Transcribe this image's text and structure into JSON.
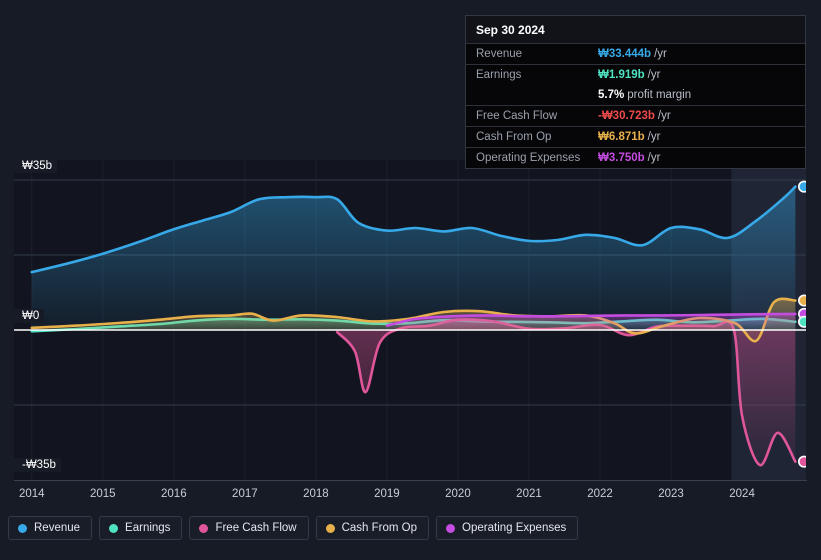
{
  "chart_data": {
    "type": "area",
    "title": "",
    "xlabel": "",
    "ylabel": "",
    "currency_symbol": "₩",
    "units": "b",
    "grid": true,
    "legend_position": "bottom",
    "xlim": [
      2013.75,
      2024.9
    ],
    "ylim": [
      -35,
      35
    ],
    "x_ticks": [
      "2014",
      "2015",
      "2016",
      "2017",
      "2018",
      "2019",
      "2020",
      "2021",
      "2022",
      "2023",
      "2024"
    ],
    "y_ticks": [
      "₩35b",
      "₩0",
      "-₩35b"
    ],
    "y_tick_values": [
      35,
      0,
      -35
    ],
    "gridline_values": [
      35,
      17.5,
      -17.5
    ],
    "zero_line_value": 0,
    "forecast_band_start_x": 2023.85,
    "series": [
      {
        "name": "Revenue",
        "color": "#37a9e8",
        "x": [
          2014.0,
          2014.5,
          2015.0,
          2015.5,
          2016.0,
          2016.4,
          2016.8,
          2017.2,
          2017.6,
          2018.0,
          2018.3,
          2018.6,
          2019.0,
          2019.4,
          2019.8,
          2020.2,
          2020.6,
          2021.0,
          2021.4,
          2021.8,
          2022.2,
          2022.6,
          2023.0,
          2023.4,
          2023.8,
          2024.2,
          2024.6,
          2024.75
        ],
        "values": [
          13.5,
          15.5,
          17.8,
          20.5,
          23.5,
          25.5,
          27.5,
          30.5,
          31.0,
          31.0,
          30.5,
          25.0,
          23.2,
          23.8,
          23.0,
          23.8,
          22.0,
          20.8,
          21.0,
          22.2,
          21.5,
          19.8,
          23.8,
          23.5,
          21.5,
          25.5,
          31.0,
          33.444
        ]
      },
      {
        "name": "Earnings",
        "color": "#50e3c2",
        "x": [
          2014.0,
          2014.6,
          2015.2,
          2015.8,
          2016.3,
          2016.8,
          2017.3,
          2017.8,
          2018.3,
          2018.8,
          2019.3,
          2019.8,
          2020.3,
          2020.8,
          2021.3,
          2021.8,
          2022.3,
          2022.8,
          2023.3,
          2023.8,
          2024.3,
          2024.75
        ],
        "values": [
          -0.3,
          0.2,
          0.8,
          1.4,
          2.2,
          2.6,
          2.4,
          2.5,
          2.2,
          1.5,
          1.6,
          2.3,
          2.0,
          1.9,
          1.8,
          1.6,
          2.0,
          2.4,
          1.8,
          2.2,
          2.6,
          1.919
        ]
      },
      {
        "name": "Free Cash Flow",
        "color": "#e0569a",
        "x": [
          2018.3,
          2018.55,
          2018.7,
          2018.9,
          2019.2,
          2019.6,
          2020.0,
          2020.5,
          2021.0,
          2021.5,
          2022.0,
          2022.4,
          2022.8,
          2023.2,
          2023.6,
          2023.88,
          2024.0,
          2024.25,
          2024.5,
          2024.75
        ],
        "values": [
          -0.5,
          -5.0,
          -14.5,
          -3.0,
          0.4,
          1.0,
          2.4,
          2.0,
          0.3,
          0.4,
          1.2,
          -1.2,
          0.8,
          1.0,
          0.9,
          0.3,
          -20.0,
          -31.5,
          -24.0,
          -30.723
        ]
      },
      {
        "name": "Cash From Op",
        "color": "#e8b04b",
        "x": [
          2014.0,
          2014.6,
          2015.2,
          2015.8,
          2016.3,
          2016.8,
          2017.1,
          2017.4,
          2017.8,
          2018.3,
          2018.8,
          2019.3,
          2019.8,
          2020.3,
          2020.8,
          2021.3,
          2021.8,
          2022.2,
          2022.5,
          2022.9,
          2023.4,
          2023.9,
          2024.2,
          2024.45,
          2024.75
        ],
        "values": [
          0.5,
          1.0,
          1.6,
          2.4,
          3.2,
          3.4,
          3.8,
          2.2,
          3.4,
          3.0,
          2.0,
          2.6,
          4.2,
          4.4,
          3.4,
          3.2,
          3.4,
          1.6,
          -0.8,
          1.0,
          2.8,
          1.6,
          -2.5,
          6.5,
          6.871
        ]
      },
      {
        "name": "Operating Expenses",
        "color": "#c44ce0",
        "x": [
          2019.0,
          2019.4,
          2019.9,
          2020.4,
          2020.9,
          2021.4,
          2021.9,
          2022.4,
          2022.9,
          2023.4,
          2023.9,
          2024.3,
          2024.75
        ],
        "values": [
          1.0,
          2.6,
          3.2,
          3.4,
          3.2,
          3.2,
          3.3,
          3.4,
          3.4,
          3.5,
          3.6,
          3.7,
          3.75
        ]
      }
    ],
    "endpoints": [
      {
        "name": "Revenue",
        "value": 33.444,
        "color": "#37a9e8"
      },
      {
        "name": "Cash From Op",
        "value": 6.871,
        "color": "#e8b04b"
      },
      {
        "name": "Operating Expenses",
        "value": 3.75,
        "color": "#c44ce0"
      },
      {
        "name": "Earnings",
        "value": 1.919,
        "color": "#50e3c2"
      },
      {
        "name": "Free Cash Flow",
        "value": -30.723,
        "color": "#e0569a"
      }
    ]
  },
  "tooltip": {
    "date": "Sep 30 2024",
    "rows": [
      {
        "key": "Revenue",
        "value": "₩33.444b",
        "unit": "/yr",
        "color": "#37a9e8"
      },
      {
        "key": "Earnings",
        "value": "₩1.919b",
        "unit": "/yr",
        "color": "#50e3c2"
      },
      {
        "key": "",
        "pct": "5.7%",
        "pct_label": "profit margin"
      },
      {
        "key": "Free Cash Flow",
        "value": "-₩30.723b",
        "unit": "/yr",
        "color": "#ef4b4b"
      },
      {
        "key": "Cash From Op",
        "value": "₩6.871b",
        "unit": "/yr",
        "color": "#e8b04b"
      },
      {
        "key": "Operating Expenses",
        "value": "₩3.750b",
        "unit": "/yr",
        "color": "#c44ce0"
      }
    ]
  },
  "legend": {
    "items": [
      {
        "label": "Revenue",
        "color": "#37a9e8"
      },
      {
        "label": "Earnings",
        "color": "#50e3c2"
      },
      {
        "label": "Free Cash Flow",
        "color": "#e0569a"
      },
      {
        "label": "Cash From Op",
        "color": "#e8b04b"
      },
      {
        "label": "Operating Expenses",
        "color": "#c44ce0"
      }
    ]
  },
  "axis": {
    "y_top": "₩35b",
    "y_zero": "₩0",
    "y_bottom": "-₩35b"
  }
}
